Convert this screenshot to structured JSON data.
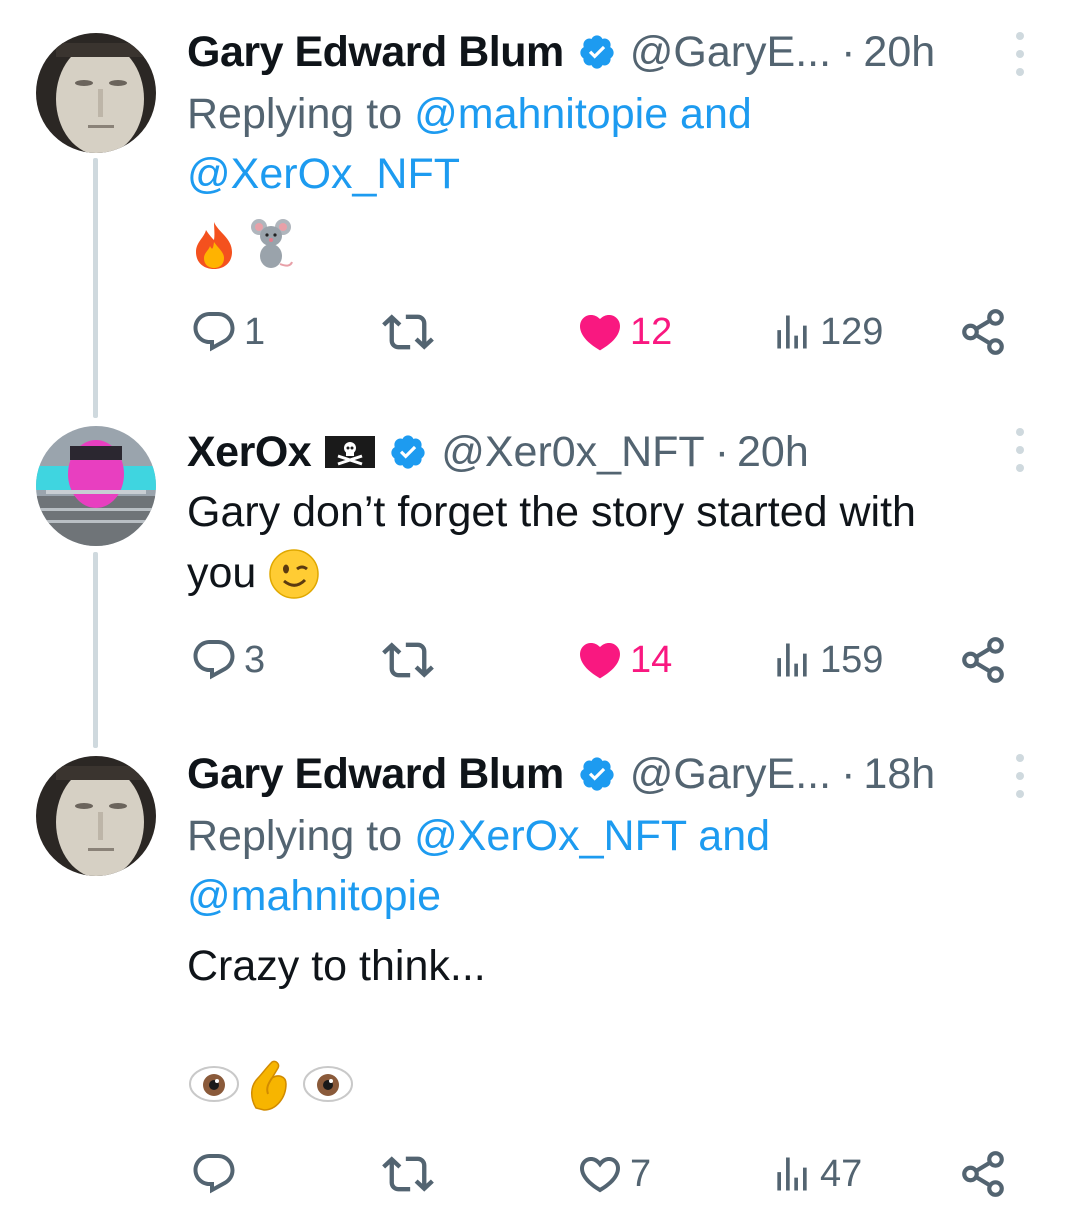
{
  "tweets": [
    {
      "name": "Gary Edward Blum",
      "handle": "@GaryE...",
      "time": "20h",
      "reply_prefix": "Replying to",
      "reply_line1_mention": "@mahnitopie and",
      "reply_line2_mention": "@XerOx_NFT",
      "emojis": [
        "fire-emoji",
        "mouse-emoji"
      ],
      "stats": {
        "replies": "1",
        "likes": "12",
        "views": "129"
      },
      "liked": true
    },
    {
      "name": "XerOx",
      "handle": "@Xer0x_NFT",
      "time": "20h",
      "text_line1": "Gary don’t forget the story started with",
      "text_line2": "you",
      "stats": {
        "replies": "3",
        "likes": "14",
        "views": "159"
      },
      "liked": true
    },
    {
      "name": "Gary Edward Blum",
      "handle": "@GaryE...",
      "time": "18h",
      "reply_prefix": "Replying to",
      "reply_line1_mention": "@XerOx_NFT and",
      "reply_line2_mention": "@mahnitopie",
      "text_line1": "Crazy to think...",
      "emojis": [
        "eyes-emoji",
        "pinching-hand-emoji",
        "eyes-emoji"
      ],
      "stats": {
        "replies": "",
        "likes": "7",
        "views": "47"
      },
      "liked": false
    }
  ],
  "separator": "·",
  "colors": {
    "verified": "#1d9bf0",
    "like_active": "#f91880",
    "secondary_text": "#536471",
    "mention": "#1d9bf0",
    "thread_line": "#cfd9de"
  }
}
